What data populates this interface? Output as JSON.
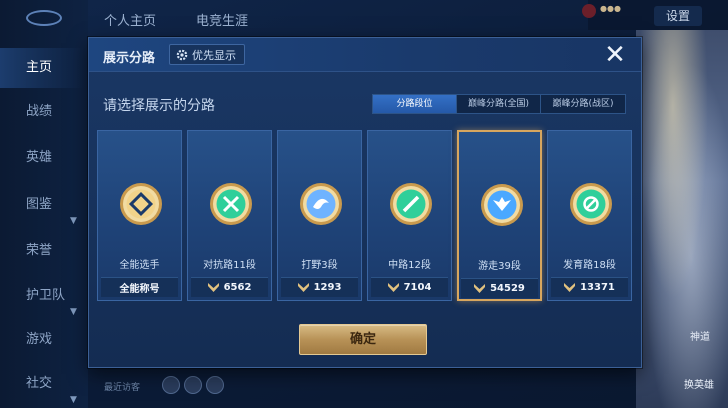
{
  "background": {
    "top_tabs": [
      "个人主页",
      "电竞生涯"
    ],
    "settings_label": "设置",
    "sidebar": [
      {
        "label": "主页",
        "active": true
      },
      {
        "label": "战绩",
        "active": false
      },
      {
        "label": "英雄",
        "active": false
      },
      {
        "label": "图鉴",
        "active": false,
        "dot": true
      },
      {
        "label": "荣誉",
        "active": false
      },
      {
        "label": "护卫队",
        "active": false,
        "dot": true
      },
      {
        "label": "游戏",
        "active": false
      },
      {
        "label": "社交",
        "active": false,
        "dot": true
      }
    ],
    "hero_labels": [
      "神道",
      "换英雄"
    ],
    "bottom_hint": "最近访客"
  },
  "modal": {
    "title": "展示分路",
    "priority_button": "优先显示",
    "prompt": "请选择展示的分路",
    "tabs": [
      {
        "label": "分路段位",
        "active": true
      },
      {
        "label": "巅峰分路(全国)",
        "active": false
      },
      {
        "label": "巅峰分路(战区)",
        "active": false
      }
    ],
    "cards": [
      {
        "name": "全能选手",
        "stat": "全能称号",
        "show_icon": false,
        "selected": false,
        "badge": "allround",
        "accent": "#f2d38a"
      },
      {
        "name": "对抗路11段",
        "stat": "6562",
        "show_icon": true,
        "selected": false,
        "badge": "clash",
        "accent": "#2fcf9a"
      },
      {
        "name": "打野3段",
        "stat": "1293",
        "show_icon": true,
        "selected": false,
        "badge": "jungle",
        "accent": "#6fb3ff"
      },
      {
        "name": "中路12段",
        "stat": "7104",
        "show_icon": true,
        "selected": false,
        "badge": "mid",
        "accent": "#2fcf9a"
      },
      {
        "name": "游走39段",
        "stat": "54529",
        "show_icon": true,
        "selected": true,
        "badge": "roam",
        "accent": "#4aa8ff"
      },
      {
        "name": "发育路18段",
        "stat": "13371",
        "show_icon": true,
        "selected": false,
        "badge": "farm",
        "accent": "#2fcf9a"
      }
    ],
    "confirm_label": "确定"
  },
  "colors": {
    "gold": "#d7a65e",
    "panel": "#1a3764",
    "accent_blue": "#2f6cc2"
  }
}
